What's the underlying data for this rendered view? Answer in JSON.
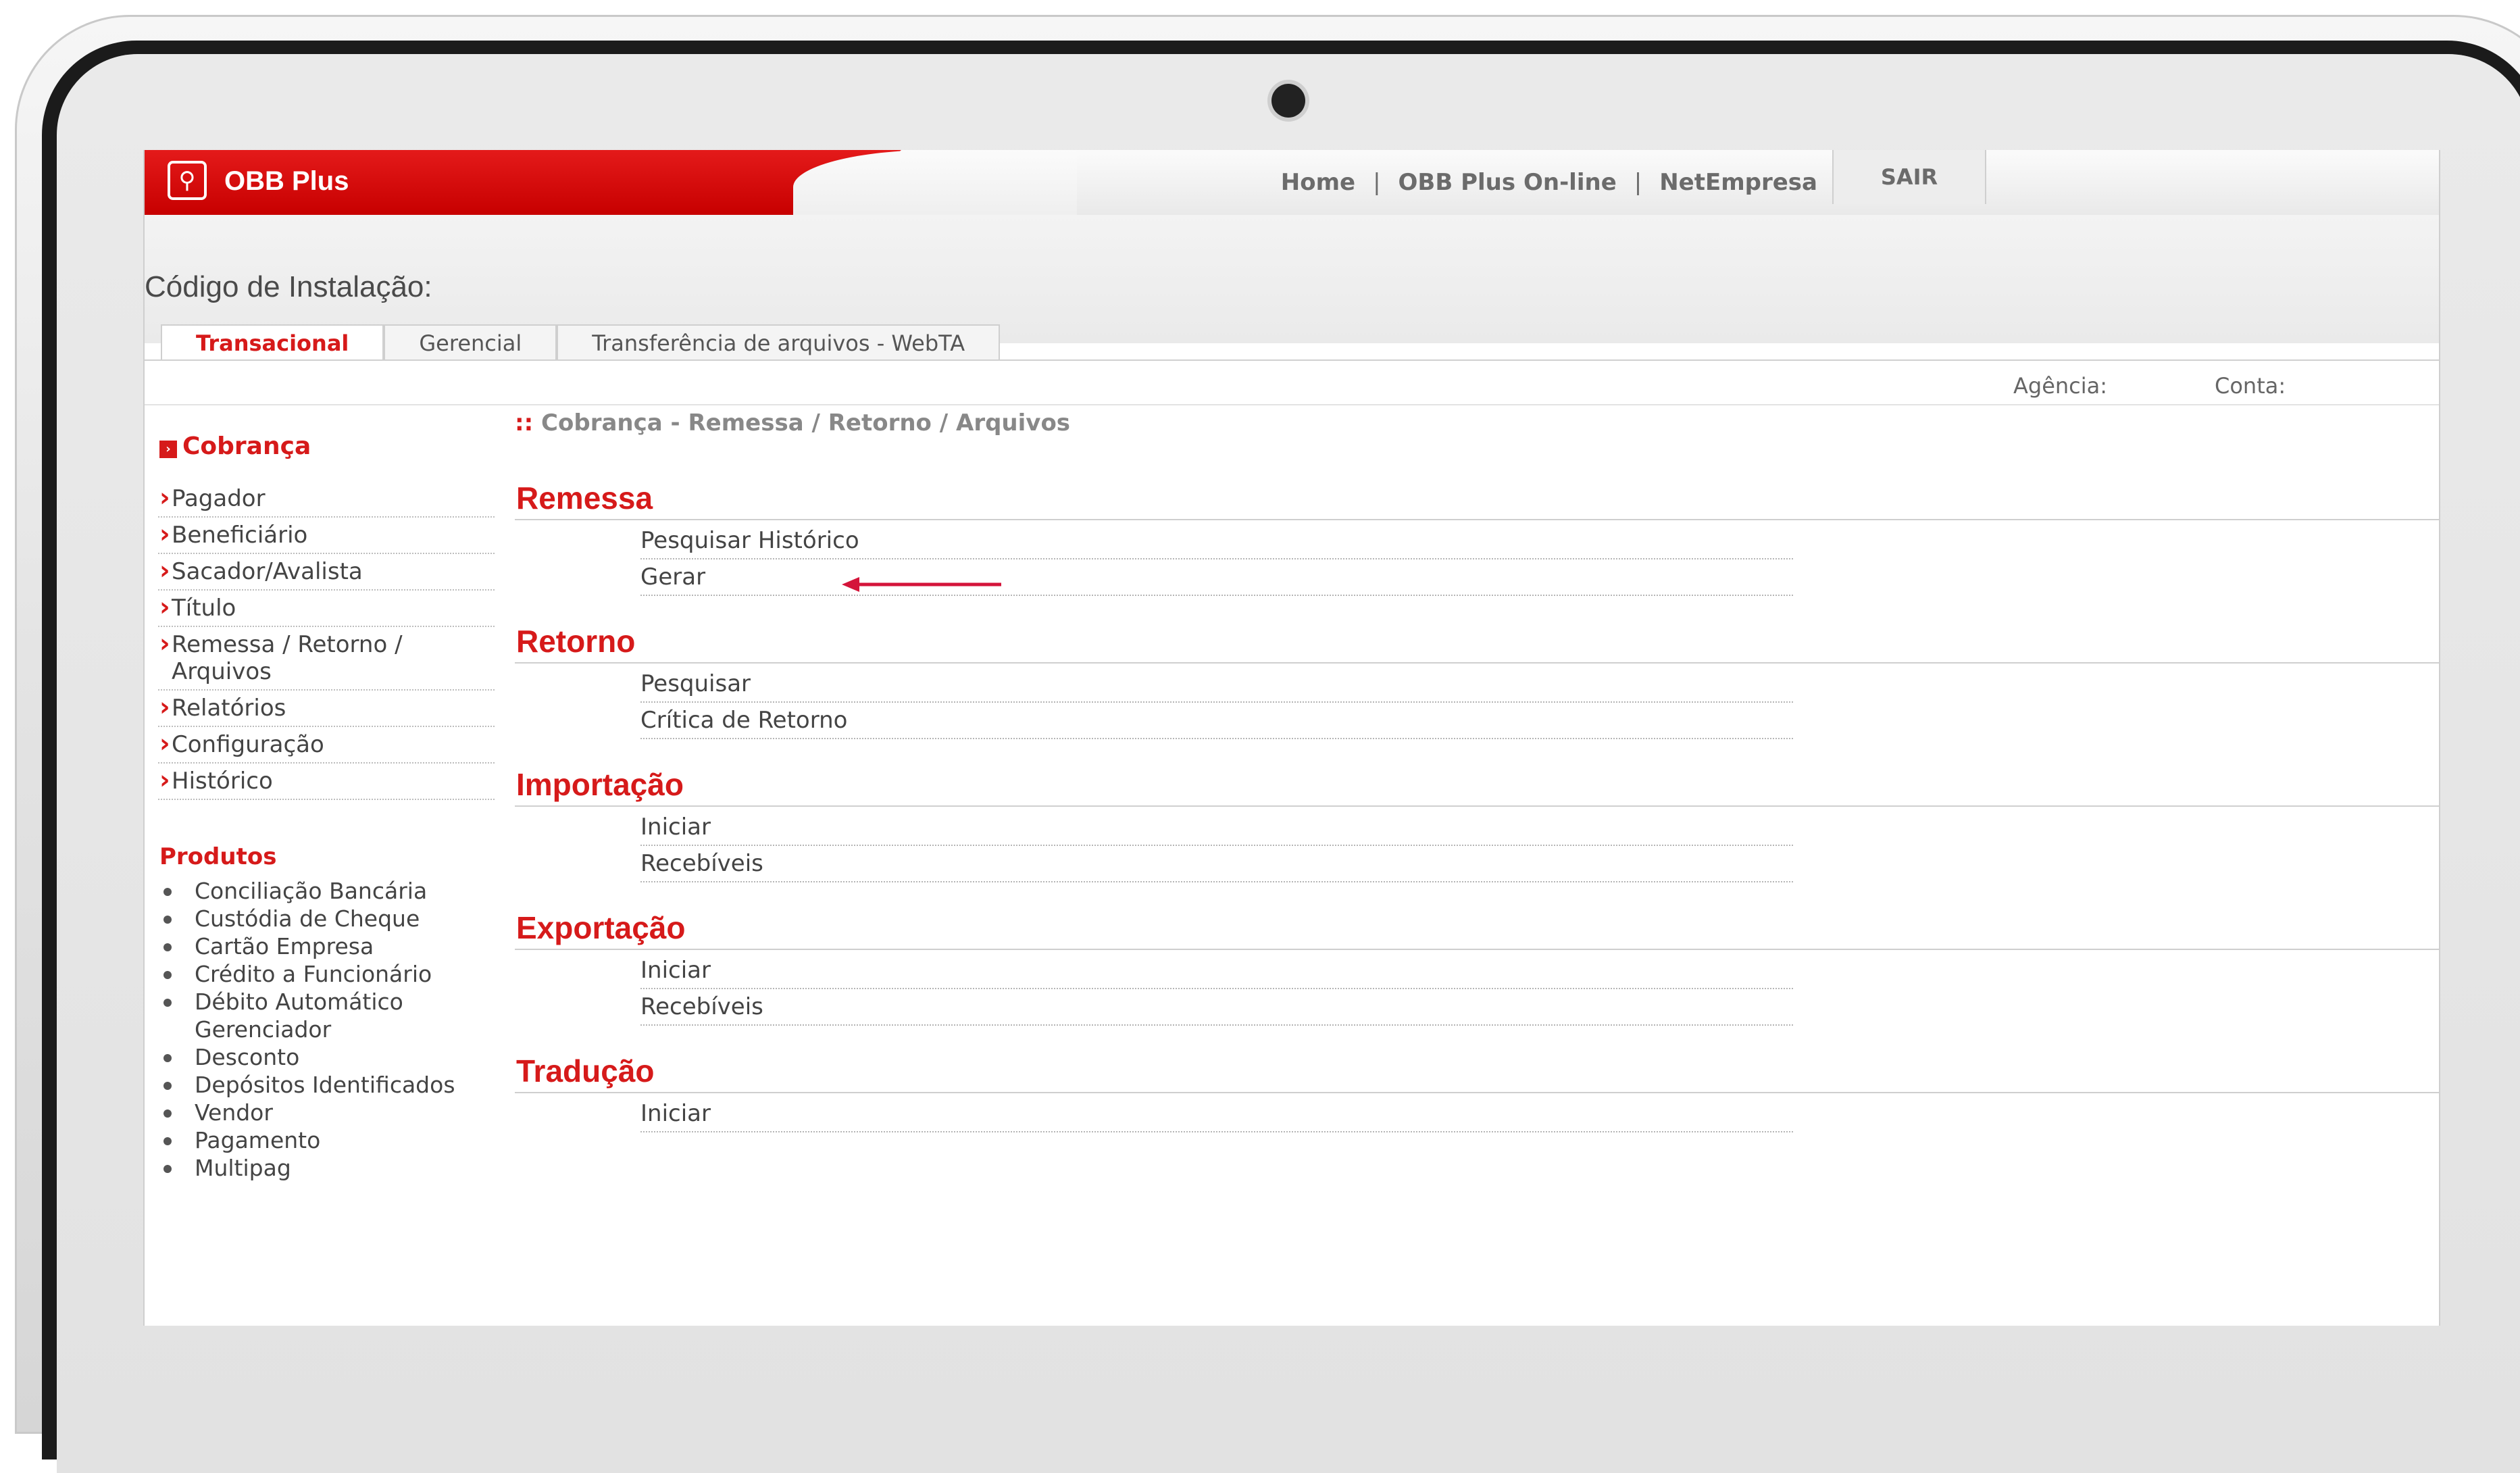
{
  "header": {
    "brand_name": "OBB Plus",
    "nav": [
      "Home",
      "OBB Plus On-line",
      "NetEmpresa"
    ],
    "nav_separator": "|",
    "logout_label": "SAIR"
  },
  "install_label": "Código de Instalação:",
  "tabs": [
    {
      "label": "Transacional",
      "active": true
    },
    {
      "label": "Gerencial",
      "active": false
    },
    {
      "label": "Transferência de arquivos - WebTA",
      "active": false
    }
  ],
  "account": {
    "agencia_label": "Agência:",
    "conta_label": "Conta:"
  },
  "sidebar": {
    "section_title": "Cobrança",
    "items": [
      "Pagador",
      "Beneficiário",
      "Sacador/Avalista",
      "Título",
      "Remessa / Retorno / Arquivos",
      "Relatórios",
      "Configuração",
      "Histórico"
    ],
    "products_title": "Produtos",
    "products": [
      "Conciliação Bancária",
      "Custódia de Cheque",
      "Cartão Empresa",
      "Crédito a Funcionário",
      "Débito Automático Gerenciador",
      "Desconto",
      "Depósitos Identificados",
      "Vendor",
      "Pagamento",
      "Multipag"
    ]
  },
  "breadcrumb": {
    "marker": "::",
    "text": "Cobrança - Remessa / Retorno / Arquivos"
  },
  "sections": [
    {
      "title": "Remessa",
      "links": [
        "Pesquisar Histórico",
        "Gerar"
      ]
    },
    {
      "title": "Retorno",
      "links": [
        "Pesquisar",
        "Crítica de Retorno"
      ]
    },
    {
      "title": "Importação",
      "links": [
        "Iniciar",
        "Recebíveis"
      ]
    },
    {
      "title": "Exportação",
      "links": [
        "Iniciar",
        "Recebíveis"
      ]
    },
    {
      "title": "Tradução",
      "links": [
        "Iniciar"
      ]
    }
  ],
  "colors": {
    "brand_red": "#d61a1a",
    "annotation_arrow": "#d4143a"
  },
  "icons": {
    "logo": "bank-logo-icon",
    "annotation": "arrow-left-icon"
  }
}
